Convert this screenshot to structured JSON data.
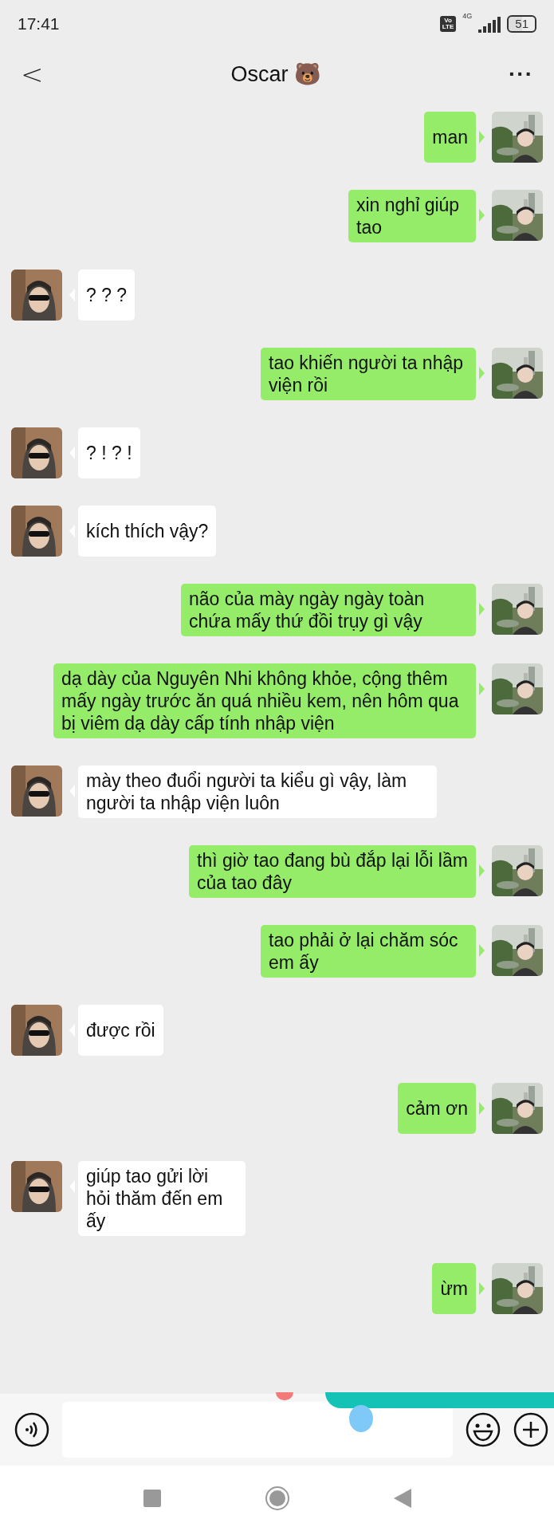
{
  "status_bar": {
    "time": "17:41",
    "volte": [
      "Vo",
      "LTE"
    ],
    "network": "4G",
    "battery": "51"
  },
  "header": {
    "back": "<",
    "title": "Oscar 🐻",
    "more": "···"
  },
  "messages": [
    {
      "kind": "sent",
      "text": "man"
    },
    {
      "kind": "sent",
      "text": "xin nghỉ giúp tao"
    },
    {
      "kind": "received",
      "text": "? ? ?"
    },
    {
      "kind": "sent",
      "text": "tao khiến người ta nhập viện rồi"
    },
    {
      "kind": "received",
      "text": "? ! ? !"
    },
    {
      "kind": "received",
      "text": "kích thích vậy?"
    },
    {
      "kind": "sent",
      "text": "não của mày ngày ngày toàn chứa mấy thứ đồi trụy gì vậy"
    },
    {
      "kind": "sent",
      "text": "dạ dày của Nguyên Nhi không khỏe, cộng thêm mấy ngày trước ăn quá nhiều kem, nên hôm qua bị viêm dạ dày cấp tính nhập viện"
    },
    {
      "kind": "received",
      "text": "mày theo đuổi người ta kiểu gì vậy, làm người ta nhập viện luôn"
    },
    {
      "kind": "sent",
      "text": "thì giờ tao đang bù đắp lại lỗi lầm của tao đây"
    },
    {
      "kind": "sent",
      "text": "tao phải ở lại chăm sóc em ấy"
    },
    {
      "kind": "received",
      "text": "được rồi"
    },
    {
      "kind": "sent",
      "text": "cảm ơn"
    },
    {
      "kind": "received",
      "text": "giúp tao gửi lời hỏi thăm đến em ấy"
    },
    {
      "kind": "sent",
      "text": "ừm"
    }
  ]
}
